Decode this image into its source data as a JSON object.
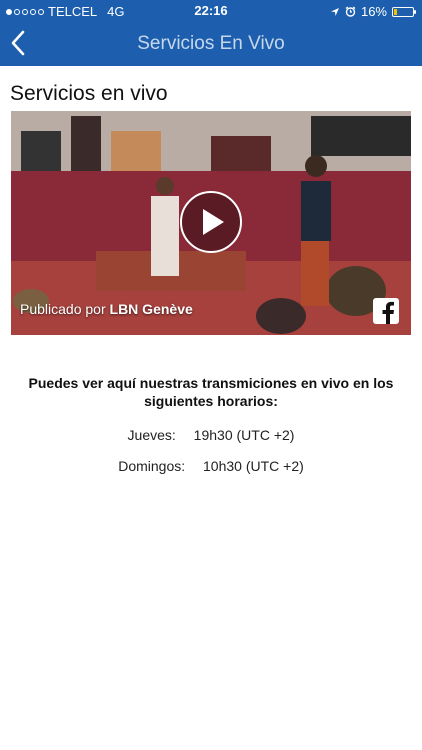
{
  "status_bar": {
    "carrier": "TELCEL",
    "network": "4G",
    "time": "22:16",
    "battery": "16%",
    "battery_level_percent": 16,
    "signal_bars_filled": 1
  },
  "nav": {
    "back_icon": "chevron-left-icon",
    "title": "Servicios En Vivo"
  },
  "page": {
    "section_title": "Servicios en vivo"
  },
  "video": {
    "published_prefix": "Publicado por",
    "publisher": "LBN Genève",
    "play_icon": "play-icon",
    "brand_icon": "facebook-icon"
  },
  "info": {
    "heading": "Puedes ver aquí nuestras transmiciones en vivo en los siguientes horarios:",
    "schedule": [
      {
        "day": "Jueves:",
        "time": "19h30 (UTC +2)"
      },
      {
        "day": "Domingos:",
        "time": "10h30 (UTC +2)"
      }
    ]
  },
  "colors": {
    "nav_background": "#1d5fae",
    "battery_low": "#f2c200"
  }
}
